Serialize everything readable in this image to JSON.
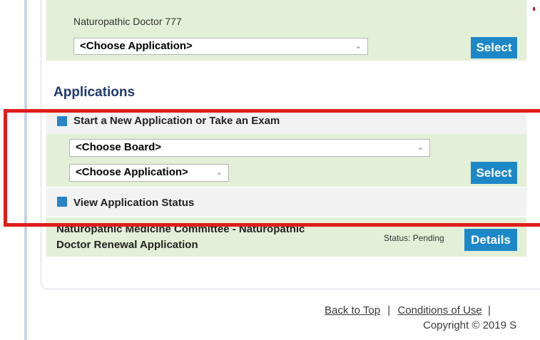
{
  "top_panel": {
    "label": "Naturopathic Doctor  777",
    "application_select": "<Choose Application>",
    "select_button": "Select"
  },
  "applications": {
    "heading": "Applications",
    "new_application": {
      "title": "Start a New Application or Take an Exam",
      "board_select": "<Choose Board>",
      "application_select": "<Choose Application>",
      "select_button": "Select"
    },
    "status": {
      "title": "View Application Status",
      "row": {
        "line1": "Naturopathic Medicine Committee - Naturopathic",
        "line2": "Doctor Renewal Application",
        "status": "Status: Pending",
        "details_button": "Details"
      }
    }
  },
  "footer": {
    "back_to_top": "Back to Top",
    "separator": "|",
    "conditions": "Conditions of Use",
    "copyright": "Copyright © 2019 S"
  },
  "colors": {
    "accent_blue": "#1d88c8",
    "panel_green": "#e3efd6",
    "heading_navy": "#1f3a6e",
    "highlight_red": "#e01c1c"
  }
}
